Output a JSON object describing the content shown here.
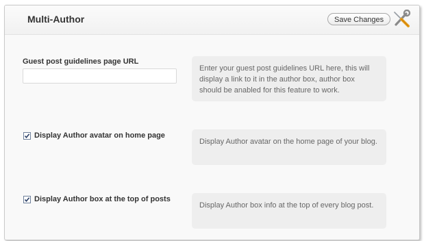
{
  "header": {
    "title": "Multi-Author",
    "save_label": "Save Changes",
    "tools_icon": "screwdriver-wrench-icon"
  },
  "settings": [
    {
      "label": "Guest post guidelines page URL",
      "type": "text",
      "value": "",
      "description": "Enter your guest post guidelines URL here, this will display a link to it in the author box, author box should be anabled for this feature to work."
    },
    {
      "label": "Display Author avatar on home page",
      "type": "checkbox",
      "checked": true,
      "description": "Display Author avatar on the home page of your blog."
    },
    {
      "label": "Display Author box at the top of posts",
      "type": "checkbox",
      "checked": true,
      "description": "Display Author box info at the top of every blog post."
    }
  ]
}
